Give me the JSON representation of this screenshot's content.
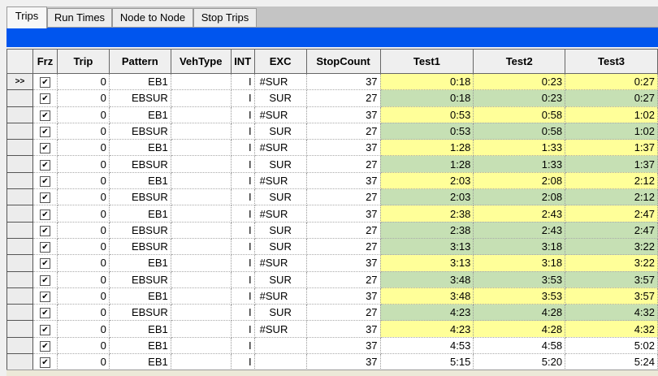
{
  "tabs": [
    {
      "label": "Trips",
      "active": true
    },
    {
      "label": "Run Times"
    },
    {
      "label": "Node to Node"
    },
    {
      "label": "Stop Trips"
    }
  ],
  "columns": [
    "",
    "Frz",
    "Trip",
    "Pattern",
    "VehType",
    "INT",
    "EXC",
    "StopCount",
    "Test1",
    "Test2",
    "Test3"
  ],
  "current_row_marker": ">>",
  "colors": {
    "yellow": "#ffff99",
    "green": "#c6e0b4",
    "bar": "#0055ee"
  },
  "rows": [
    {
      "frz": true,
      "trip": "0",
      "pattern": "EB1",
      "veh": "",
      "int": "I",
      "exc": "#SUR",
      "stops": "37",
      "t1": "0:18",
      "t2": "0:23",
      "t3": "0:27",
      "hl": "y"
    },
    {
      "frz": true,
      "trip": "0",
      "pattern": "EBSUR",
      "veh": "",
      "int": "I",
      "exc": "SUR",
      "stops": "27",
      "t1": "0:18",
      "t2": "0:23",
      "t3": "0:27",
      "hl": "g"
    },
    {
      "frz": true,
      "trip": "0",
      "pattern": "EB1",
      "veh": "",
      "int": "I",
      "exc": "#SUR",
      "stops": "37",
      "t1": "0:53",
      "t2": "0:58",
      "t3": "1:02",
      "hl": "y"
    },
    {
      "frz": true,
      "trip": "0",
      "pattern": "EBSUR",
      "veh": "",
      "int": "I",
      "exc": "SUR",
      "stops": "27",
      "t1": "0:53",
      "t2": "0:58",
      "t3": "1:02",
      "hl": "g"
    },
    {
      "frz": true,
      "trip": "0",
      "pattern": "EB1",
      "veh": "",
      "int": "I",
      "exc": "#SUR",
      "stops": "37",
      "t1": "1:28",
      "t2": "1:33",
      "t3": "1:37",
      "hl": "y"
    },
    {
      "frz": true,
      "trip": "0",
      "pattern": "EBSUR",
      "veh": "",
      "int": "I",
      "exc": "SUR",
      "stops": "27",
      "t1": "1:28",
      "t2": "1:33",
      "t3": "1:37",
      "hl": "g"
    },
    {
      "frz": true,
      "trip": "0",
      "pattern": "EB1",
      "veh": "",
      "int": "I",
      "exc": "#SUR",
      "stops": "37",
      "t1": "2:03",
      "t2": "2:08",
      "t3": "2:12",
      "hl": "y"
    },
    {
      "frz": true,
      "trip": "0",
      "pattern": "EBSUR",
      "veh": "",
      "int": "I",
      "exc": "SUR",
      "stops": "27",
      "t1": "2:03",
      "t2": "2:08",
      "t3": "2:12",
      "hl": "g"
    },
    {
      "frz": true,
      "trip": "0",
      "pattern": "EB1",
      "veh": "",
      "int": "I",
      "exc": "#SUR",
      "stops": "37",
      "t1": "2:38",
      "t2": "2:43",
      "t3": "2:47",
      "hl": "y"
    },
    {
      "frz": true,
      "trip": "0",
      "pattern": "EBSUR",
      "veh": "",
      "int": "I",
      "exc": "SUR",
      "stops": "27",
      "t1": "2:38",
      "t2": "2:43",
      "t3": "2:47",
      "hl": "g"
    },
    {
      "frz": true,
      "trip": "0",
      "pattern": "EBSUR",
      "veh": "",
      "int": "I",
      "exc": "SUR",
      "stops": "27",
      "t1": "3:13",
      "t2": "3:18",
      "t3": "3:22",
      "hl": "g"
    },
    {
      "frz": true,
      "trip": "0",
      "pattern": "EB1",
      "veh": "",
      "int": "I",
      "exc": "#SUR",
      "stops": "37",
      "t1": "3:13",
      "t2": "3:18",
      "t3": "3:22",
      "hl": "y"
    },
    {
      "frz": true,
      "trip": "0",
      "pattern": "EBSUR",
      "veh": "",
      "int": "I",
      "exc": "SUR",
      "stops": "27",
      "t1": "3:48",
      "t2": "3:53",
      "t3": "3:57",
      "hl": "g"
    },
    {
      "frz": true,
      "trip": "0",
      "pattern": "EB1",
      "veh": "",
      "int": "I",
      "exc": "#SUR",
      "stops": "37",
      "t1": "3:48",
      "t2": "3:53",
      "t3": "3:57",
      "hl": "y"
    },
    {
      "frz": true,
      "trip": "0",
      "pattern": "EBSUR",
      "veh": "",
      "int": "I",
      "exc": "SUR",
      "stops": "27",
      "t1": "4:23",
      "t2": "4:28",
      "t3": "4:32",
      "hl": "g"
    },
    {
      "frz": true,
      "trip": "0",
      "pattern": "EB1",
      "veh": "",
      "int": "I",
      "exc": "#SUR",
      "stops": "37",
      "t1": "4:23",
      "t2": "4:28",
      "t3": "4:32",
      "hl": "y"
    },
    {
      "frz": true,
      "trip": "0",
      "pattern": "EB1",
      "veh": "",
      "int": "I",
      "exc": "",
      "stops": "37",
      "t1": "4:53",
      "t2": "4:58",
      "t3": "5:02",
      "hl": ""
    },
    {
      "frz": true,
      "trip": "0",
      "pattern": "EB1",
      "veh": "",
      "int": "I",
      "exc": "",
      "stops": "37",
      "t1": "5:15",
      "t2": "5:20",
      "t3": "5:24",
      "hl": ""
    }
  ]
}
